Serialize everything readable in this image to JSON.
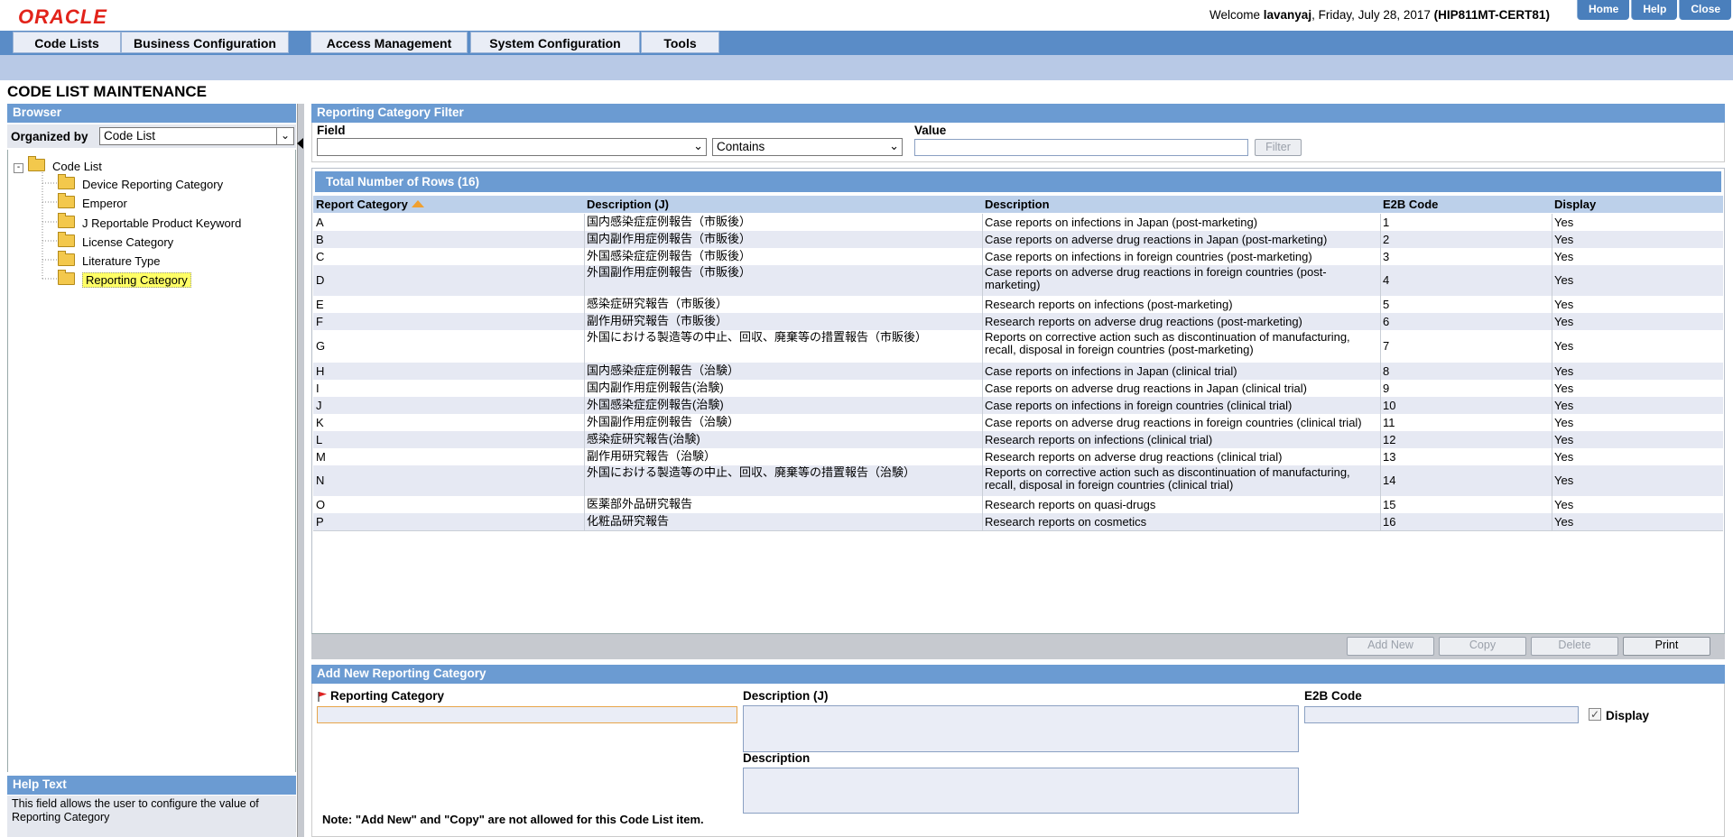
{
  "app": {
    "logo": "ORACLE"
  },
  "header": {
    "welcome_prefix": "Welcome ",
    "user": "lavanyaj",
    "date": ", Friday, July 28, 2017 ",
    "server": "(HIP811MT-CERT81)",
    "links": [
      "Home",
      "Help",
      "Close"
    ]
  },
  "menu": [
    "Code Lists",
    "Business Configuration",
    "Access Management",
    "System Configuration",
    "Tools"
  ],
  "page_title": "CODE LIST MAINTENANCE",
  "browser": {
    "title": "Browser",
    "organized_by_label": "Organized by",
    "organized_by_value": "Code List",
    "root": "Code List",
    "items": [
      "Device Reporting Category",
      "Emperor",
      "J Reportable Product Keyword",
      "License Category",
      "Literature Type",
      "Reporting Category"
    ],
    "selected": "Reporting Category"
  },
  "help": {
    "title": "Help Text",
    "text": "This field allows the user to configure the value of Reporting Category"
  },
  "filter": {
    "title": "Reporting Category Filter",
    "field_label": "Field",
    "field_value": "",
    "operator_value": "Contains",
    "value_label": "Value",
    "value_value": "",
    "filter_button": "Filter"
  },
  "grid": {
    "title": "Total Number of Rows (16)",
    "columns": [
      "Report Category",
      "Description (J)",
      "Description",
      "E2B Code",
      "Display"
    ],
    "rows": [
      [
        "A",
        "国内感染症症例報告（市販後）",
        "Case reports on infections in Japan (post-marketing)",
        "1",
        "Yes"
      ],
      [
        "B",
        "国内副作用症例報告（市販後）",
        "Case reports on adverse drug reactions in Japan (post-marketing)",
        "2",
        "Yes"
      ],
      [
        "C",
        "外国感染症症例報告（市販後）",
        "Case reports on infections in foreign countries (post-marketing)",
        "3",
        "Yes"
      ],
      [
        "D",
        "外国副作用症例報告（市販後）",
        "Case reports on adverse drug reactions in foreign countries (post-marketing)",
        "4",
        "Yes"
      ],
      [
        "E",
        "感染症研究報告（市販後）",
        "Research reports on infections (post-marketing)",
        "5",
        "Yes"
      ],
      [
        "F",
        "副作用研究報告（市販後）",
        "Research reports on adverse drug reactions (post-marketing)",
        "6",
        "Yes"
      ],
      [
        "G",
        "外国における製造等の中止、回収、廃棄等の措置報告（市販後）",
        "Reports on corrective action such as discontinuation of manufacturing, recall, disposal in foreign countries (post-marketing)",
        "7",
        "Yes"
      ],
      [
        "H",
        "国内感染症症例報告（治験）",
        "Case reports on infections in Japan (clinical trial)",
        "8",
        "Yes"
      ],
      [
        "I",
        "国内副作用症例報告(治験)",
        "Case reports on adverse drug reactions in Japan (clinical trial)",
        "9",
        "Yes"
      ],
      [
        "J",
        "外国感染症症例報告(治験)",
        "Case reports on infections in foreign countries (clinical trial)",
        "10",
        "Yes"
      ],
      [
        "K",
        "外国副作用症例報告（治験）",
        "Case reports on adverse drug reactions in foreign countries (clinical trial)",
        "11",
        "Yes"
      ],
      [
        "L",
        "感染症研究報告(治験)",
        "Research reports on infections (clinical trial)",
        "12",
        "Yes"
      ],
      [
        "M",
        "副作用研究報告（治験）",
        "Research reports on adverse drug reactions (clinical trial)",
        "13",
        "Yes"
      ],
      [
        "N",
        "外国における製造等の中止、回収、廃棄等の措置報告（治験）",
        "Reports on corrective action such as discontinuation of manufacturing, recall, disposal in foreign countries (clinical trial)",
        "14",
        "Yes"
      ],
      [
        "O",
        "医薬部外品研究報告",
        "Research reports on quasi-drugs",
        "15",
        "Yes"
      ],
      [
        "P",
        "化粧品研究報告",
        "Research reports on cosmetics",
        "16",
        "Yes"
      ]
    ],
    "buttons": [
      "Add New",
      "Copy",
      "Delete",
      "Print"
    ]
  },
  "add_new": {
    "title": "Add New Reporting Category",
    "reporting_category_label": "Reporting Category",
    "reporting_category_value": "",
    "desc_j_label": "Description (J)",
    "desc_j_value": "",
    "description_label": "Description",
    "description_value": "",
    "e2b_label": "E2B Code",
    "e2b_value": "",
    "display_label": "Display",
    "display_checked": true,
    "note": "Note: \"Add New\" and \"Copy\" are not allowed for this Code List item."
  }
}
